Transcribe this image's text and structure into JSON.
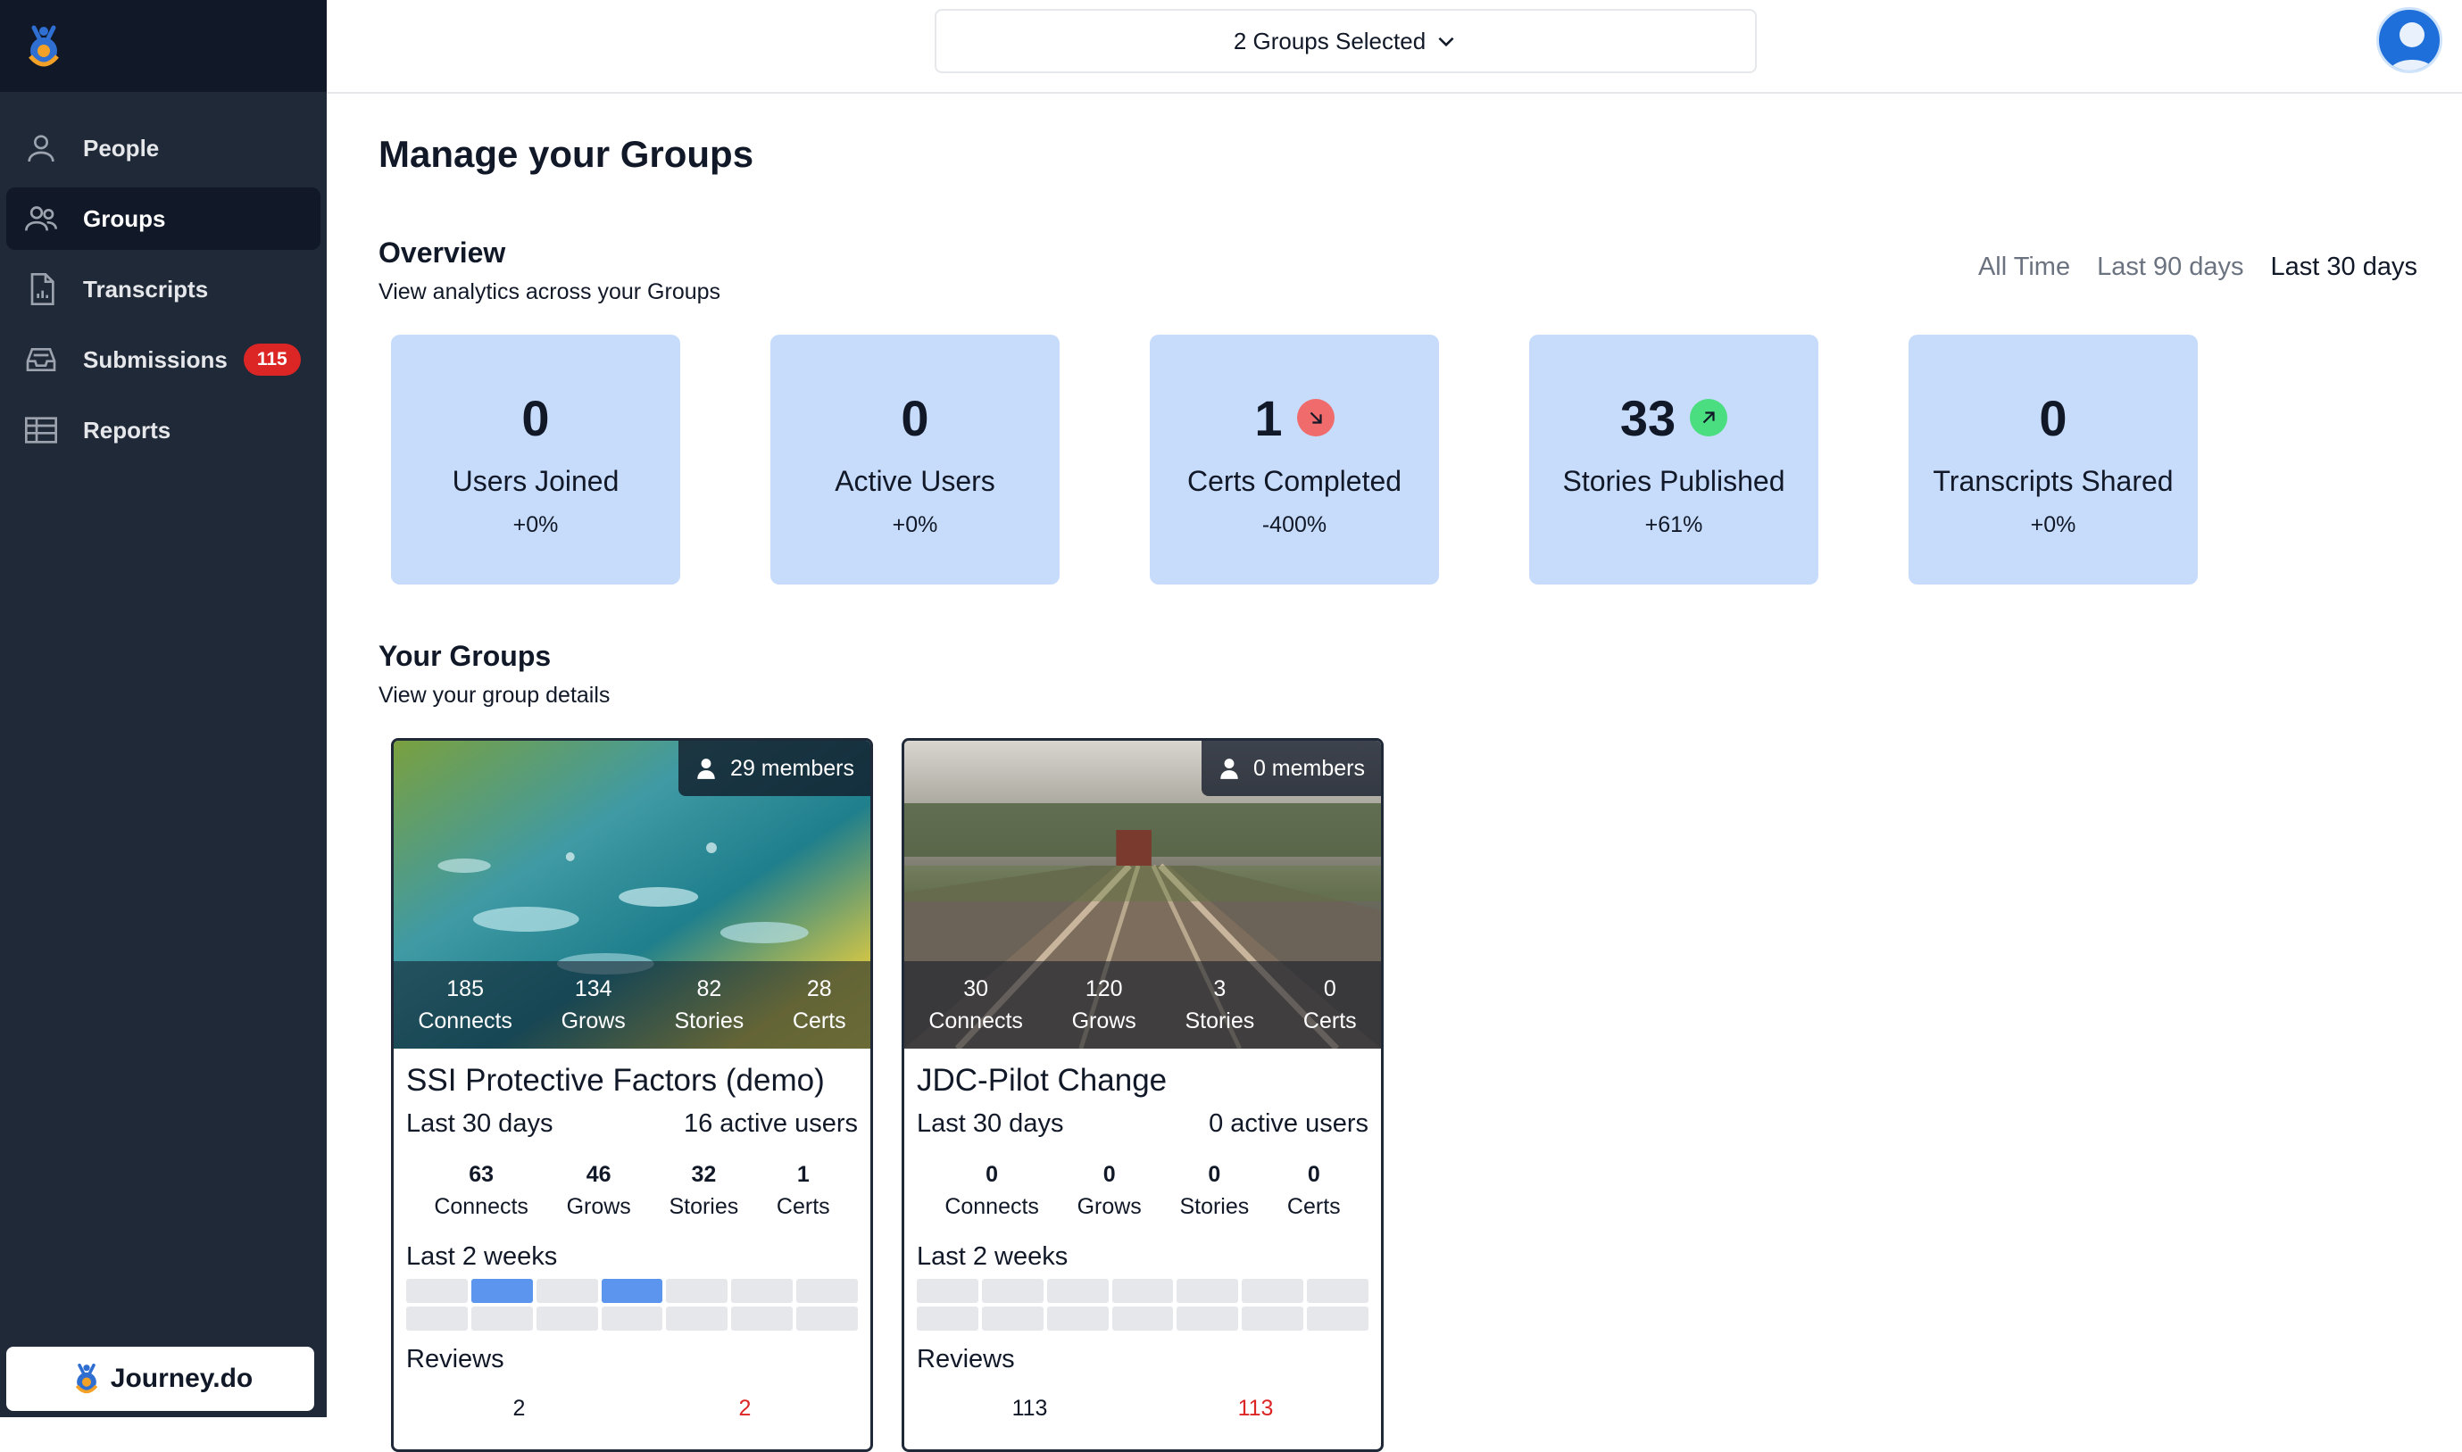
{
  "sidebar": {
    "items": [
      {
        "label": "People",
        "icon": "person-icon"
      },
      {
        "label": "Groups",
        "icon": "groups-icon"
      },
      {
        "label": "Transcripts",
        "icon": "document-chart-icon"
      },
      {
        "label": "Submissions",
        "icon": "inbox-icon",
        "badge": "115"
      },
      {
        "label": "Reports",
        "icon": "table-icon"
      }
    ],
    "active": "Groups",
    "brand": "Journey.do"
  },
  "topbar": {
    "group_selector": "2 Groups Selected"
  },
  "page": {
    "title": "Manage your Groups"
  },
  "overview": {
    "title": "Overview",
    "subtitle": "View analytics across your Groups",
    "ranges": [
      "All Time",
      "Last 90 days",
      "Last 30 days"
    ],
    "active_range": "Last 30 days",
    "stats": [
      {
        "value": "0",
        "label": "Users Joined",
        "change": "+0%"
      },
      {
        "value": "0",
        "label": "Active Users",
        "change": "+0%"
      },
      {
        "value": "1",
        "label": "Certs Completed",
        "change": "-400%",
        "trend": "down"
      },
      {
        "value": "33",
        "label": "Stories Published",
        "change": "+61%",
        "trend": "up"
      },
      {
        "value": "0",
        "label": "Transcripts Shared",
        "change": "+0%"
      }
    ]
  },
  "your_groups": {
    "title": "Your Groups",
    "subtitle": "View your group details",
    "cards": [
      {
        "name": "SSI Protective Factors (demo)",
        "members": "29 members",
        "totals": [
          {
            "value": "185",
            "label": "Connects"
          },
          {
            "value": "134",
            "label": "Grows"
          },
          {
            "value": "82",
            "label": "Stories"
          },
          {
            "value": "28",
            "label": "Certs"
          }
        ],
        "period": "Last 30 days",
        "active_users": "16 active users",
        "period_stats": [
          {
            "value": "63",
            "label": "Connects"
          },
          {
            "value": "46",
            "label": "Grows"
          },
          {
            "value": "32",
            "label": "Stories"
          },
          {
            "value": "1",
            "label": "Certs"
          }
        ],
        "weeks_label": "Last 2 weeks",
        "activity": [
          0,
          1,
          0,
          1,
          0,
          0,
          0,
          0,
          0,
          0,
          0,
          0,
          0,
          0
        ],
        "reviews_label": "Reviews",
        "reviews": [
          "2",
          "2"
        ]
      },
      {
        "name": "JDC-Pilot Change",
        "members": "0 members",
        "totals": [
          {
            "value": "30",
            "label": "Connects"
          },
          {
            "value": "120",
            "label": "Grows"
          },
          {
            "value": "3",
            "label": "Stories"
          },
          {
            "value": "0",
            "label": "Certs"
          }
        ],
        "period": "Last 30 days",
        "active_users": "0 active users",
        "period_stats": [
          {
            "value": "0",
            "label": "Connects"
          },
          {
            "value": "0",
            "label": "Grows"
          },
          {
            "value": "0",
            "label": "Stories"
          },
          {
            "value": "0",
            "label": "Certs"
          }
        ],
        "weeks_label": "Last 2 weeks",
        "activity": [
          0,
          0,
          0,
          0,
          0,
          0,
          0,
          0,
          0,
          0,
          0,
          0,
          0,
          0
        ],
        "reviews_label": "Reviews",
        "reviews": [
          "113",
          "113"
        ]
      }
    ]
  },
  "colors": {
    "sidebar": "#1f2937",
    "sidebar_header": "#111827",
    "stat_card": "#c7dcfb",
    "badge": "#dc2626",
    "activity_on": "#5b95ee",
    "trend_down": "#f06b6b",
    "trend_up": "#4ade80"
  }
}
